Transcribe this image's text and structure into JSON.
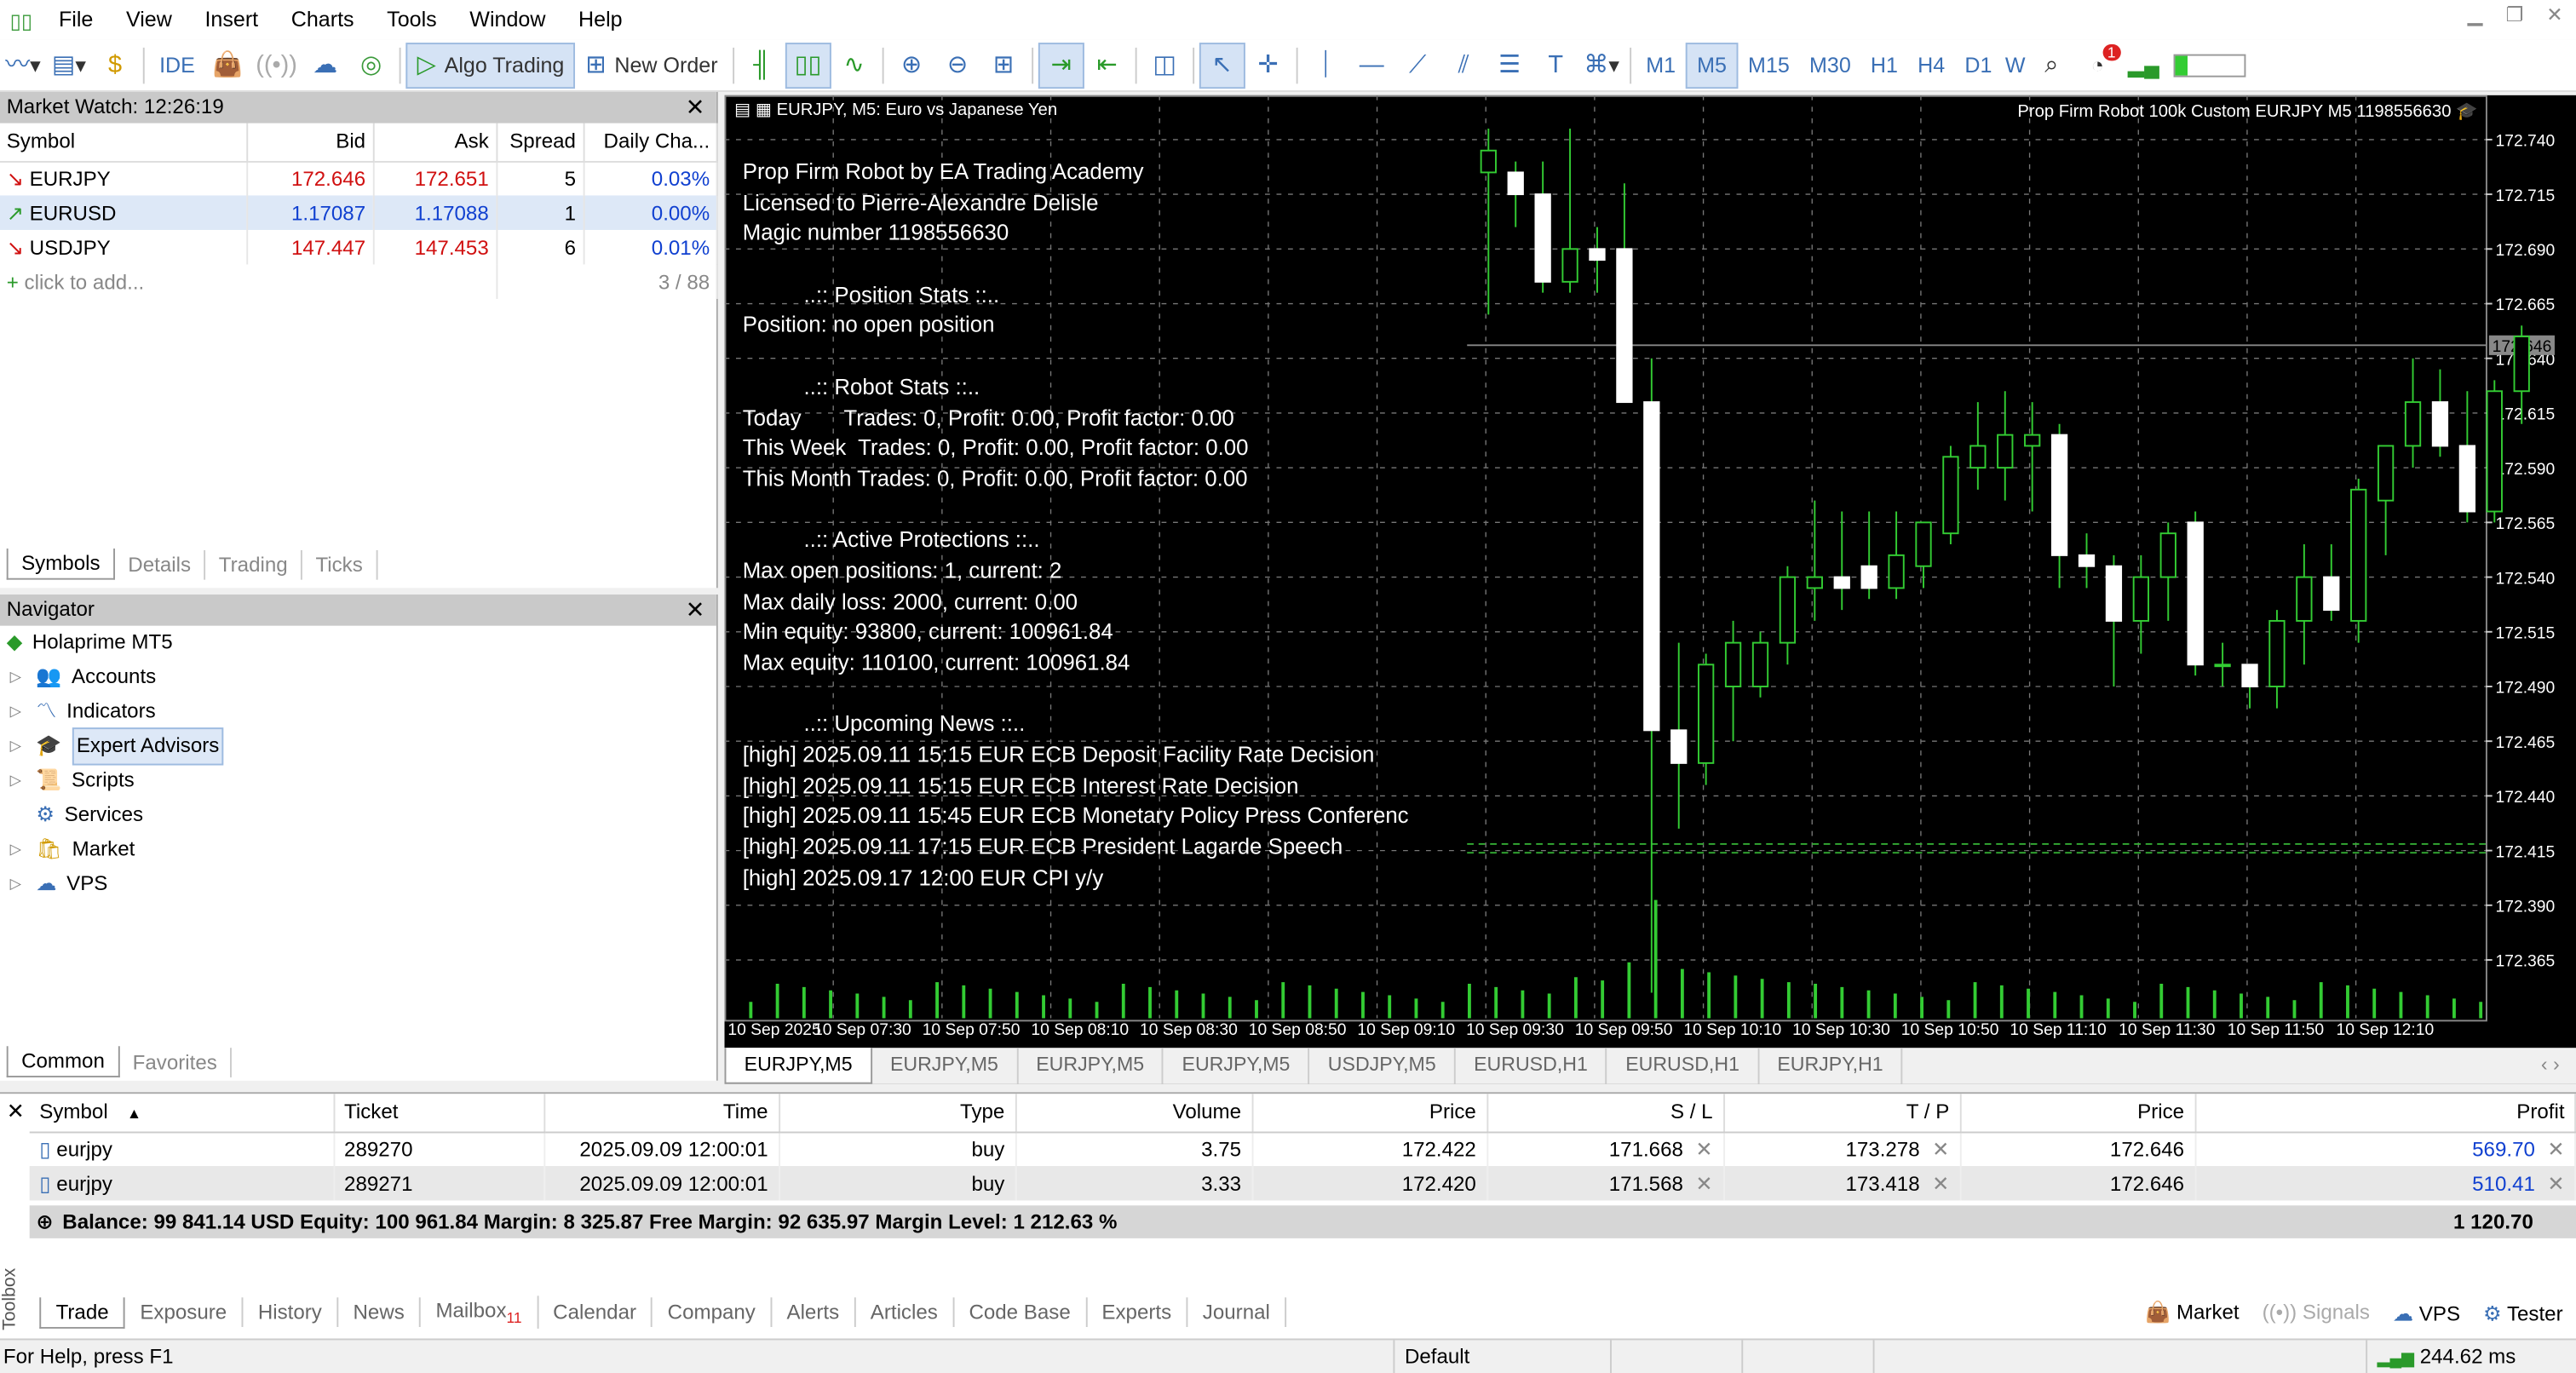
{
  "menu": [
    "File",
    "View",
    "Insert",
    "Charts",
    "Tools",
    "Window",
    "Help"
  ],
  "toolbar": {
    "ide": "IDE",
    "algo": "Algo Trading",
    "new_order": "New Order",
    "notif_count": "1"
  },
  "timeframes": [
    "M1",
    "M5",
    "M15",
    "M30",
    "H1",
    "H4",
    "D1",
    "W"
  ],
  "market_watch": {
    "title": "Market Watch: 12:26:19",
    "columns": [
      "Symbol",
      "Bid",
      "Ask",
      "Spread",
      "Daily Cha..."
    ],
    "rows": [
      {
        "dir": "↘",
        "symbol": "EURJPY",
        "bid": "172.646",
        "ask": "172.651",
        "spread": "5",
        "change": "0.03%"
      },
      {
        "dir": "↗",
        "symbol": "EURUSD",
        "bid": "1.17087",
        "ask": "1.17088",
        "spread": "1",
        "change": "0.00%"
      },
      {
        "dir": "↘",
        "symbol": "USDJPY",
        "bid": "147.447",
        "ask": "147.453",
        "spread": "6",
        "change": "0.01%"
      }
    ],
    "add": "click to add...",
    "count": "3 / 88",
    "tabs": [
      "Symbols",
      "Details",
      "Trading",
      "Ticks"
    ]
  },
  "navigator": {
    "title": "Navigator",
    "root": "Holaprime MT5",
    "items": [
      "Accounts",
      "Indicators",
      "Expert Advisors",
      "Scripts",
      "Services",
      "Market",
      "VPS"
    ],
    "tabs": [
      "Common",
      "Favorites"
    ]
  },
  "chart": {
    "title": "EURJPY, M5:  Euro vs Japanese Yen",
    "robot_label": "Prop Firm Robot 100k Custom EURJPY M5 1198556630",
    "price_marker": "172.646",
    "info_lines": [
      "Prop Firm Robot by EA Trading Academy",
      "Licensed to Pierre-Alexandre Delisle",
      "Magic number 1198556630",
      "",
      "          ..:: Position Stats ::..",
      "Position: no open position",
      "",
      "          ..:: Robot Stats ::..",
      "Today       Trades: 0, Profit: 0.00, Profit factor: 0.00",
      "This Week  Trades: 0, Profit: 0.00, Profit factor: 0.00",
      "This Month Trades: 0, Profit: 0.00, Profit factor: 0.00",
      "",
      "          ..:: Active Protections ::..",
      "Max open positions: 1, current: 2",
      "Max daily loss: 2000, current: 0.00",
      "Min equity: 93800, current: 100961.84",
      "Max equity: 110100, current: 100961.84",
      "",
      "          ..:: Upcoming News ::..",
      "[high] 2025.09.11 15:15 EUR ECB Deposit Facility Rate Decision",
      "[high] 2025.09.11 15:15 EUR ECB Interest Rate Decision",
      "[high] 2025.09.11 15:45 EUR ECB Monetary Policy Press Conferenc",
      "[high] 2025.09.11 17:15 EUR ECB President Lagarde Speech",
      "[high] 2025.09.17 12:00 EUR CPI y/y"
    ],
    "price_ticks": [
      "172.740",
      "172.715",
      "172.690",
      "172.665",
      "172.640",
      "172.615",
      "172.590",
      "172.565",
      "172.540",
      "172.515",
      "172.490",
      "172.465",
      "172.440",
      "172.415",
      "172.390",
      "172.365"
    ],
    "time_ticks": [
      "10 Sep 2025",
      "10 Sep 07:30",
      "10 Sep 07:50",
      "10 Sep 08:10",
      "10 Sep 08:30",
      "10 Sep 08:50",
      "10 Sep 09:10",
      "10 Sep 09:30",
      "10 Sep 09:50",
      "10 Sep 10:10",
      "10 Sep 10:30",
      "10 Sep 10:50",
      "10 Sep 11:10",
      "10 Sep 11:30",
      "10 Sep 11:50",
      "10 Sep 12:10"
    ],
    "tabs": [
      "EURJPY,M5",
      "EURJPY,M5",
      "EURJPY,M5",
      "EURJPY,M5",
      "USDJPY,M5",
      "EURUSD,H1",
      "EURUSD,H1",
      "EURJPY,H1"
    ]
  },
  "chart_data": {
    "type": "candlestick",
    "symbol": "EURJPY",
    "timeframe": "M5",
    "ylim": [
      172.35,
      172.755
    ],
    "bid_line": 172.646,
    "candles": [
      {
        "o": 172.725,
        "h": 172.745,
        "l": 172.66,
        "c": 172.735
      },
      {
        "o": 172.725,
        "h": 172.73,
        "l": 172.7,
        "c": 172.715
      },
      {
        "o": 172.715,
        "h": 172.73,
        "l": 172.67,
        "c": 172.675
      },
      {
        "o": 172.675,
        "h": 172.745,
        "l": 172.67,
        "c": 172.69
      },
      {
        "o": 172.69,
        "h": 172.7,
        "l": 172.67,
        "c": 172.685
      },
      {
        "o": 172.69,
        "h": 172.72,
        "l": 172.62,
        "c": 172.62
      },
      {
        "o": 172.62,
        "h": 172.64,
        "l": 172.35,
        "c": 172.47
      },
      {
        "o": 172.47,
        "h": 172.51,
        "l": 172.425,
        "c": 172.455
      },
      {
        "o": 172.455,
        "h": 172.505,
        "l": 172.445,
        "c": 172.5
      },
      {
        "o": 172.49,
        "h": 172.52,
        "l": 172.465,
        "c": 172.51
      },
      {
        "o": 172.49,
        "h": 172.515,
        "l": 172.485,
        "c": 172.51
      },
      {
        "o": 172.51,
        "h": 172.545,
        "l": 172.5,
        "c": 172.54
      },
      {
        "o": 172.535,
        "h": 172.575,
        "l": 172.52,
        "c": 172.54
      },
      {
        "o": 172.54,
        "h": 172.57,
        "l": 172.525,
        "c": 172.535
      },
      {
        "o": 172.545,
        "h": 172.57,
        "l": 172.53,
        "c": 172.535
      },
      {
        "o": 172.535,
        "h": 172.57,
        "l": 172.53,
        "c": 172.55
      },
      {
        "o": 172.545,
        "h": 172.565,
        "l": 172.535,
        "c": 172.565
      },
      {
        "o": 172.56,
        "h": 172.6,
        "l": 172.555,
        "c": 172.595
      },
      {
        "o": 172.59,
        "h": 172.62,
        "l": 172.58,
        "c": 172.6
      },
      {
        "o": 172.59,
        "h": 172.625,
        "l": 172.575,
        "c": 172.605
      },
      {
        "o": 172.6,
        "h": 172.62,
        "l": 172.57,
        "c": 172.605
      },
      {
        "o": 172.605,
        "h": 172.61,
        "l": 172.535,
        "c": 172.55
      },
      {
        "o": 172.55,
        "h": 172.56,
        "l": 172.535,
        "c": 172.545
      },
      {
        "o": 172.545,
        "h": 172.55,
        "l": 172.49,
        "c": 172.52
      },
      {
        "o": 172.52,
        "h": 172.55,
        "l": 172.505,
        "c": 172.54
      },
      {
        "o": 172.54,
        "h": 172.565,
        "l": 172.52,
        "c": 172.56
      },
      {
        "o": 172.565,
        "h": 172.57,
        "l": 172.495,
        "c": 172.5
      },
      {
        "o": 172.5,
        "h": 172.51,
        "l": 172.49,
        "c": 172.5
      },
      {
        "o": 172.5,
        "h": 172.5,
        "l": 172.48,
        "c": 172.49
      },
      {
        "o": 172.49,
        "h": 172.525,
        "l": 172.48,
        "c": 172.52
      },
      {
        "o": 172.52,
        "h": 172.555,
        "l": 172.5,
        "c": 172.54
      },
      {
        "o": 172.54,
        "h": 172.555,
        "l": 172.52,
        "c": 172.525
      },
      {
        "o": 172.52,
        "h": 172.585,
        "l": 172.51,
        "c": 172.58
      },
      {
        "o": 172.575,
        "h": 172.6,
        "l": 172.55,
        "c": 172.6
      },
      {
        "o": 172.6,
        "h": 172.64,
        "l": 172.59,
        "c": 172.62
      },
      {
        "o": 172.62,
        "h": 172.635,
        "l": 172.595,
        "c": 172.6
      },
      {
        "o": 172.6,
        "h": 172.625,
        "l": 172.565,
        "c": 172.57
      },
      {
        "o": 172.57,
        "h": 172.63,
        "l": 172.565,
        "c": 172.625
      },
      {
        "o": 172.625,
        "h": 172.655,
        "l": 172.61,
        "c": 172.65
      }
    ]
  },
  "positions": {
    "columns": [
      "Symbol",
      "Ticket",
      "Time",
      "Type",
      "Volume",
      "Price",
      "S / L",
      "T / P",
      "Price",
      "Profit"
    ],
    "rows": [
      {
        "symbol": "eurjpy",
        "ticket": "289270",
        "time": "2025.09.09 12:00:01",
        "type": "buy",
        "volume": "3.75",
        "price": "172.422",
        "sl": "171.668",
        "tp": "173.278",
        "cur": "172.646",
        "profit": "569.70"
      },
      {
        "symbol": "eurjpy",
        "ticket": "289271",
        "time": "2025.09.09 12:00:01",
        "type": "buy",
        "volume": "3.33",
        "price": "172.420",
        "sl": "171.568",
        "tp": "173.418",
        "cur": "172.646",
        "profit": "510.41"
      }
    ],
    "balance_line": "Balance: 99 841.14 USD  Equity: 100 961.84  Margin: 8 325.87  Free Margin: 92 635.97  Margin Level: 1 212.63 %",
    "total": "1 120.70"
  },
  "toolbox_label": "Toolbox",
  "toolbox_tabs": [
    "Trade",
    "Exposure",
    "History",
    "News",
    "Mailbox",
    "Calendar",
    "Company",
    "Alerts",
    "Articles",
    "Code Base",
    "Experts",
    "Journal"
  ],
  "mailbox_badge": "11",
  "right_tabs": [
    "Market",
    "Signals",
    "VPS",
    "Tester"
  ],
  "status": {
    "help": "For Help, press F1",
    "profile": "Default",
    "ping": "244.62 ms"
  }
}
